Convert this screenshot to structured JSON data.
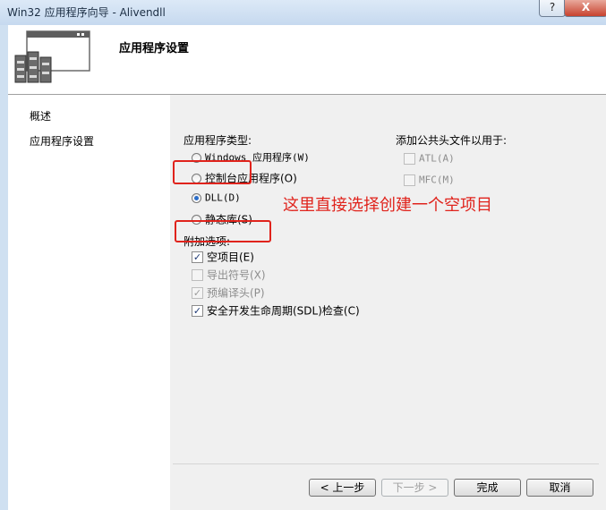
{
  "window": {
    "title": "Win32 应用程序向导 - Alivendll",
    "help_label": "?",
    "close_label": "X"
  },
  "header": {
    "title": "应用程序设置",
    "icon": "app-wizard-illustration"
  },
  "nav": {
    "items": [
      {
        "label": "概述"
      },
      {
        "label": "应用程序设置"
      }
    ]
  },
  "settings": {
    "app_type": {
      "label": "应用程序类型:",
      "options": [
        {
          "label": "Windows 应用程序(W)",
          "checked": false
        },
        {
          "label": "控制台应用程序(O)",
          "checked": false
        },
        {
          "label": "DLL(D)",
          "checked": true
        },
        {
          "label": "静态库(S)",
          "checked": false
        }
      ]
    },
    "additional": {
      "label": "附加选项:",
      "options": [
        {
          "label": "空项目(E)",
          "checked": true,
          "enabled": true
        },
        {
          "label": "导出符号(X)",
          "checked": false,
          "enabled": false
        },
        {
          "label": "预编译头(P)",
          "checked": true,
          "enabled": false
        },
        {
          "label": "安全开发生命周期(SDL)检查(C)",
          "checked": true,
          "enabled": true
        }
      ]
    },
    "common_headers": {
      "label": "添加公共头文件以用于:",
      "options": [
        {
          "label": "ATL(A)",
          "checked": false,
          "enabled": false
        },
        {
          "label": "MFC(M)",
          "checked": false,
          "enabled": false
        }
      ]
    },
    "annotation": "这里直接选择创建一个空项目"
  },
  "buttons": {
    "back": "< 上一步",
    "next": "下一步 >",
    "finish": "完成",
    "cancel": "取消"
  },
  "colors": {
    "annotation": "#e0231c",
    "radio_selected": "#2a6cc8",
    "title_bar": "#c6d9ef"
  }
}
